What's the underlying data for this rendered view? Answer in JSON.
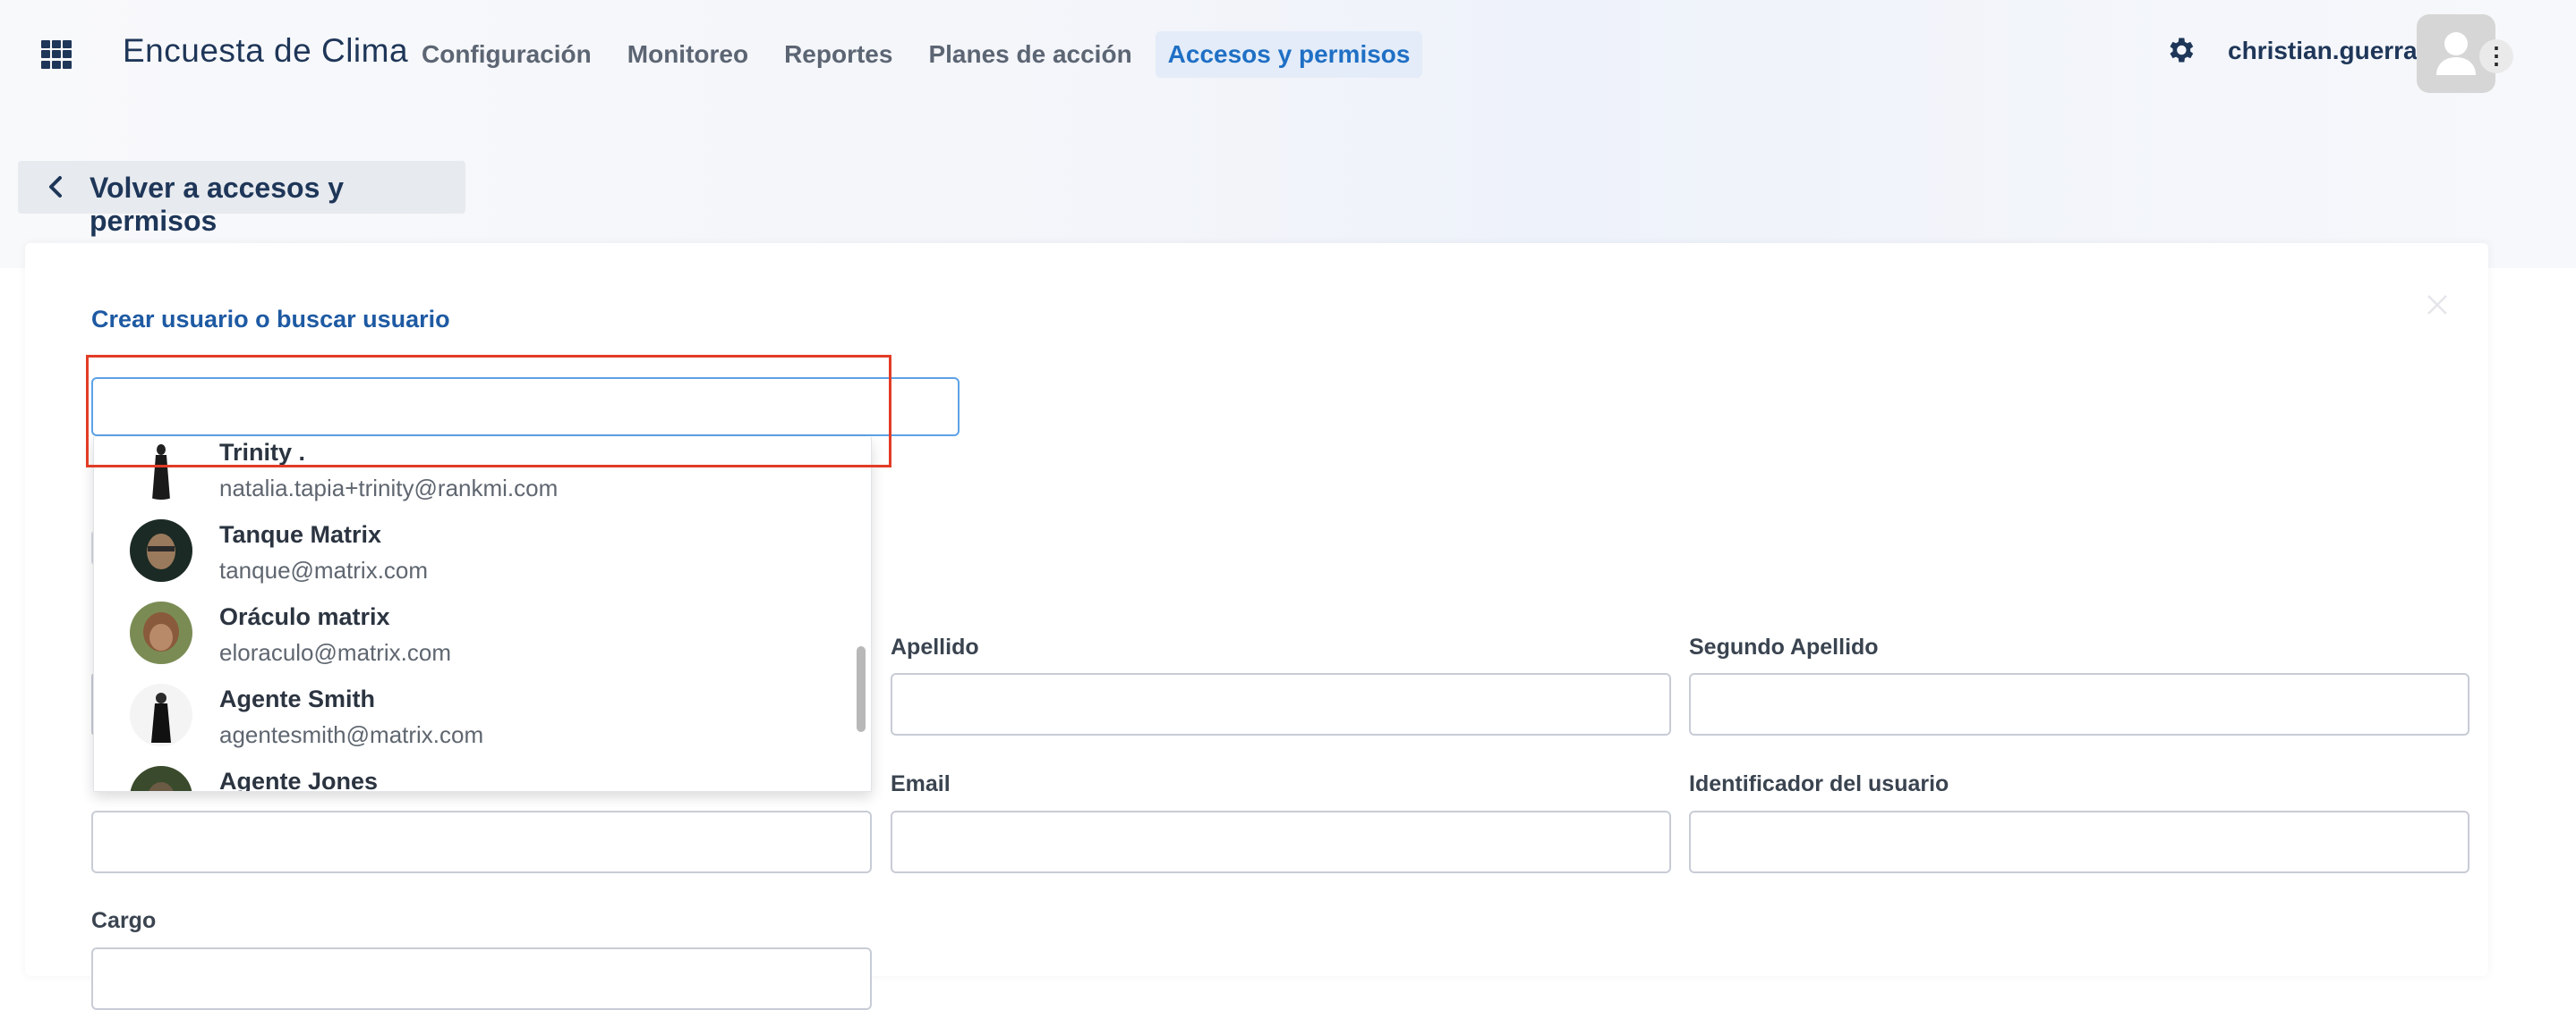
{
  "header": {
    "app_title": "Encuesta de Clima",
    "nav": [
      {
        "label": "Configuración",
        "active": false
      },
      {
        "label": "Monitoreo",
        "active": false
      },
      {
        "label": "Reportes",
        "active": false
      },
      {
        "label": "Planes de acción",
        "active": false
      },
      {
        "label": "Accesos y permisos",
        "active": true
      }
    ],
    "username": "christian.guerra",
    "avatar_menu_glyph": "⋮"
  },
  "back_button": {
    "label": "Volver a accesos y permisos"
  },
  "form": {
    "section_title": "Crear usuario o buscar usuario",
    "search": {
      "value": "",
      "placeholder": ""
    },
    "labels": {
      "apellido": "Apellido",
      "segundo_apellido": "Segundo Apellido",
      "email": "Email",
      "identificador": "Identificador del usuario",
      "cargo": "Cargo"
    }
  },
  "dropdown": {
    "options": [
      {
        "name": "Trinity .",
        "email": "natalia.tapia+trinity@rankmi.com"
      },
      {
        "name": "Tanque Matrix",
        "email": "tanque@matrix.com"
      },
      {
        "name": "Oráculo matrix",
        "email": "eloraculo@matrix.com"
      },
      {
        "name": "Agente Smith",
        "email": "agentesmith@matrix.com"
      },
      {
        "name": "Agente Jones",
        "email": ""
      }
    ]
  },
  "colors": {
    "accent": "#1f6fc5",
    "highlight_box": "#e23c26",
    "title_blue": "#1e5aa3"
  }
}
